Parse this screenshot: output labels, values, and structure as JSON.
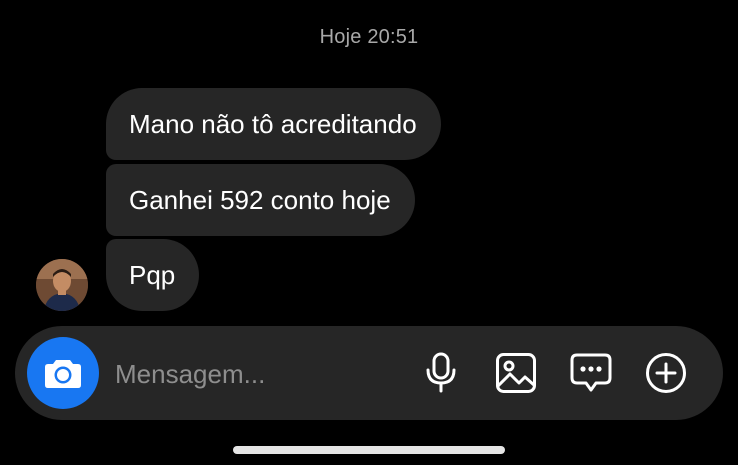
{
  "chat": {
    "timestamp": "Hoje 20:51",
    "messages": [
      {
        "text": "Mano não tô acreditando"
      },
      {
        "text": "Ganhei 592 conto hoje"
      },
      {
        "text": "Pqp"
      }
    ]
  },
  "composer": {
    "placeholder": "Mensagem...",
    "camera_icon": "camera-icon",
    "tools": [
      "microphone-icon",
      "gallery-icon",
      "sticker-icon",
      "plus-icon"
    ]
  },
  "colors": {
    "background": "#000000",
    "bubble": "#262626",
    "accent": "#1877f2",
    "timestamp": "#a8a8a8"
  }
}
